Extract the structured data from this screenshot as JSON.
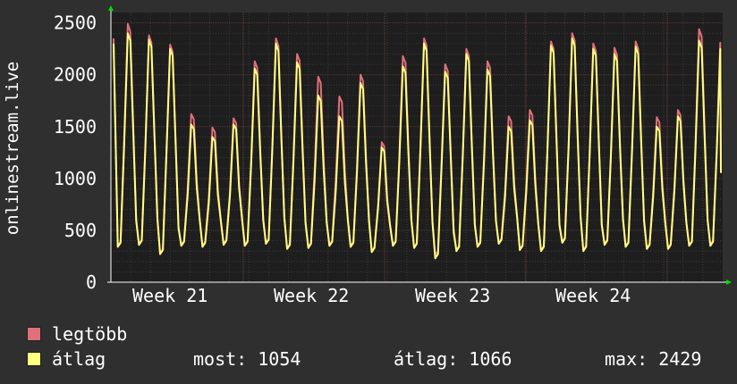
{
  "chart_data": {
    "type": "line",
    "ylabel": "onlinestream.live",
    "ylim": [
      0,
      2600
    ],
    "yticks": [
      0,
      500,
      1000,
      1500,
      2000,
      2500
    ],
    "grid": true,
    "xlabels": [
      "Week 21",
      "Week 22",
      "Week 23",
      "Week 24"
    ],
    "colors": {
      "background": "#2f2f2f",
      "plot": "#1e1e1e",
      "max_line": "#e0707a",
      "avg_line": "#ffff80",
      "grid": "#444444"
    },
    "series": [
      {
        "name": "legtöbb",
        "color": "#e0707a",
        "peaks": [
          2490,
          2380,
          2290,
          1620,
          1490,
          1580,
          2130,
          2350,
          2200,
          1980,
          1790,
          2000,
          1350,
          2180,
          2350,
          2100,
          2250,
          2130,
          1600,
          1660,
          2320,
          2400,
          2300,
          2260,
          2320,
          1590,
          1660,
          2440,
          2310
        ],
        "troughs": [
          350,
          370,
          280,
          360,
          350,
          370,
          360,
          380,
          330,
          340,
          360,
          350,
          300,
          360,
          340,
          260,
          310,
          350,
          380,
          320,
          310,
          390,
          310,
          370,
          350,
          330,
          330,
          360,
          360
        ]
      },
      {
        "name": "átlag",
        "color": "#ffff80",
        "peaks": [
          2400,
          2340,
          2250,
          1520,
          1400,
          1520,
          2060,
          2300,
          2120,
          1800,
          1600,
          1920,
          1300,
          2080,
          2300,
          2030,
          2200,
          2050,
          1500,
          1560,
          2280,
          2350,
          2250,
          2200,
          2270,
          1500,
          1600,
          2330,
          2250
        ],
        "troughs": [
          340,
          360,
          270,
          350,
          340,
          360,
          350,
          370,
          320,
          330,
          350,
          340,
          290,
          350,
          330,
          230,
          300,
          340,
          370,
          310,
          300,
          380,
          300,
          360,
          340,
          320,
          320,
          350,
          350
        ]
      }
    ]
  },
  "legend": {
    "items": [
      {
        "label": "legtöbb",
        "color": "#e0707a"
      },
      {
        "label": "átlag",
        "color": "#ffff80"
      }
    ],
    "stats": {
      "now": "most: 1054",
      "avg": "átlag: 1066",
      "max": "max: 2429"
    }
  }
}
